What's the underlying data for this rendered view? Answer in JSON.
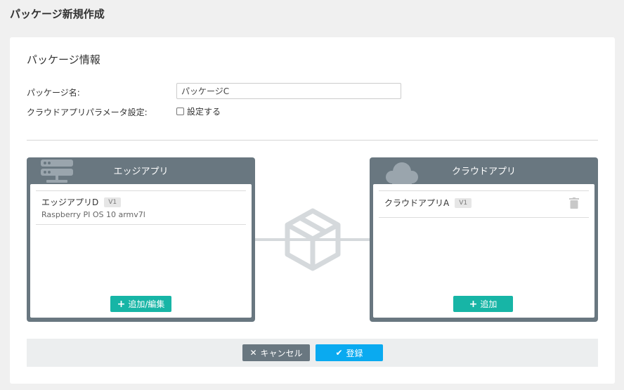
{
  "page": {
    "title": "パッケージ新規作成"
  },
  "form": {
    "section_title": "パッケージ情報",
    "name_label": "パッケージ名:",
    "name_value": "パッケージC",
    "param_label": "クラウドアプリパラメータ設定:",
    "param_checkbox_label": "設定する",
    "param_checked": false
  },
  "edge_panel": {
    "title": "エッジアプリ",
    "items": [
      {
        "name": "エッジアプリD",
        "version": "V1",
        "platform": "Raspberry PI OS 10 armv7l"
      }
    ],
    "add_button": "追加/編集"
  },
  "cloud_panel": {
    "title": "クラウドアプリ",
    "items": [
      {
        "name": "クラウドアプリA",
        "version": "V1"
      }
    ],
    "add_button": "追加"
  },
  "footer": {
    "cancel_label": "キャンセル",
    "register_label": "登録"
  },
  "colors": {
    "panel_header": "#697780",
    "teal_button": "#17b5a6",
    "register_button": "#0aaaf0",
    "connector": "#d5d9dc"
  }
}
